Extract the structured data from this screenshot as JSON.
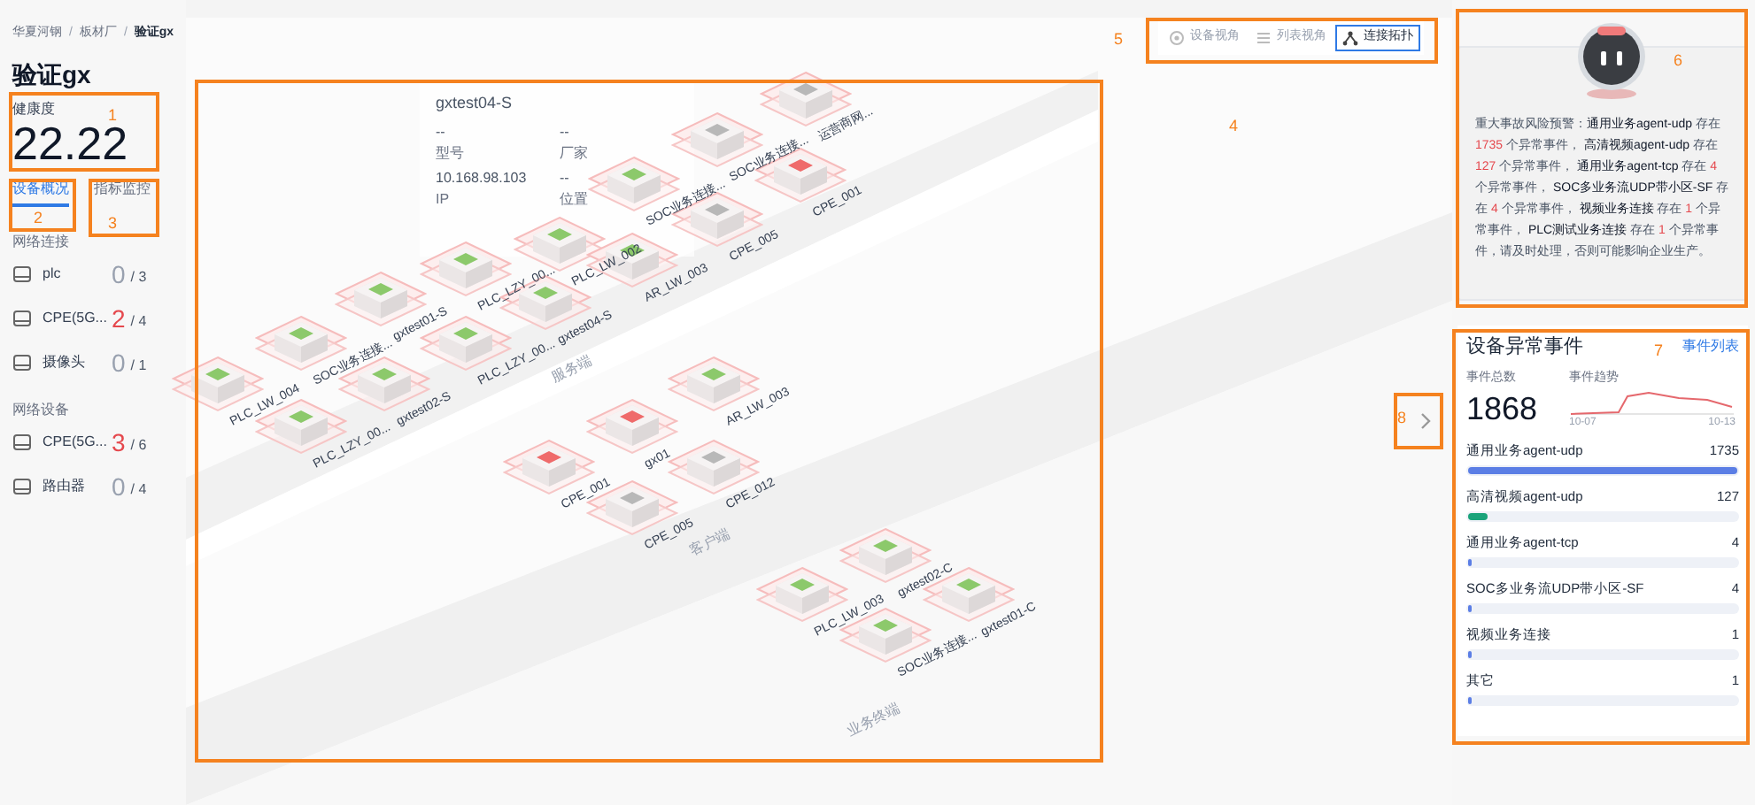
{
  "breadcrumb": [
    {
      "kind": "link",
      "text": "华夏河钢"
    },
    {
      "kind": "separator",
      "text": "/"
    },
    {
      "kind": "link",
      "text": "板材厂"
    },
    {
      "kind": "separator",
      "text": "/"
    },
    {
      "kind": "current",
      "text": "验证gx"
    }
  ],
  "title": "验证gx",
  "health": {
    "label": "健康度",
    "value": "22.22"
  },
  "tabs": [
    {
      "label": "设备概况",
      "selected": true
    },
    {
      "label": "指标监控",
      "selected": false
    }
  ],
  "device_groups": [
    {
      "title": "网络连接",
      "items": [
        {
          "name": "plc",
          "count": "0",
          "total": "/ 3",
          "alert": false
        },
        {
          "name": "CPE(5G...",
          "count": "2",
          "total": "/ 4",
          "alert": true
        },
        {
          "name": "摄像头",
          "count": "0",
          "total": "/ 1",
          "alert": false
        }
      ]
    },
    {
      "title": "网络设备",
      "items": [
        {
          "name": "CPE(5G...",
          "count": "3",
          "total": "/ 6",
          "alert": true
        },
        {
          "name": "路由器",
          "count": "0",
          "total": "/ 4",
          "alert": false
        }
      ]
    }
  ],
  "view_switch": [
    {
      "label": "设备视角",
      "selected": false
    },
    {
      "label": "列表视角",
      "selected": false
    },
    {
      "label": "连接拓扑",
      "selected": true
    }
  ],
  "tooltip": {
    "title": "gxtest04-S",
    "fields": [
      {
        "value": "--",
        "label": "型号"
      },
      {
        "value": "--",
        "label": "厂家"
      },
      {
        "value": "10.168.98.103",
        "label": "IP"
      },
      {
        "value": "--",
        "label": "位置"
      }
    ]
  },
  "topology": {
    "zones": [
      {
        "label": "服务端"
      },
      {
        "label": "客户端"
      },
      {
        "label": "业务终端"
      }
    ],
    "nodes": [
      {
        "label": "运营商网...",
        "color": "#b8b8b8"
      },
      {
        "label": "SOC业务连接...",
        "color": "#b8b8b8"
      },
      {
        "label": "CPE_001",
        "color": "#ef6b6b"
      },
      {
        "label": "SOC业务连接...",
        "color": "#8cc96b"
      },
      {
        "label": "CPE_005",
        "color": "#b8b8b8"
      },
      {
        "label": "PLC_LW_002",
        "color": "#8cc96b"
      },
      {
        "label": "AR_LW_003",
        "color": "#8cc96b"
      },
      {
        "label": "PLC_LZY_00...",
        "color": "#8cc96b"
      },
      {
        "label": "gxtest01-S",
        "color": "#8cc96b"
      },
      {
        "label": "gxtest04-S",
        "color": "#8cc96b"
      },
      {
        "label": "SOC业务连接...",
        "color": "#8cc96b"
      },
      {
        "label": "PLC_LZY_00...",
        "color": "#8cc96b"
      },
      {
        "label": "PLC_LW_004",
        "color": "#8cc96b"
      },
      {
        "label": "gxtest02-S",
        "color": "#8cc96b"
      },
      {
        "label": "PLC_LZY_00...",
        "color": "#8cc96b"
      },
      {
        "label": "AR_LW_003",
        "color": "#8cc96b"
      },
      {
        "label": "gx01",
        "color": "#ef6b6b"
      },
      {
        "label": "CPE_001",
        "color": "#ef6b6b"
      },
      {
        "label": "CPE_012",
        "color": "#b8b8b8"
      },
      {
        "label": "CPE_005",
        "color": "#b8b8b8"
      },
      {
        "label": "gxtest02-C",
        "color": "#8cc96b"
      },
      {
        "label": "PLC_LW_003",
        "color": "#8cc96b"
      },
      {
        "label": "gxtest01-C",
        "color": "#8cc96b"
      },
      {
        "label": "SOC业务连接...",
        "color": "#8cc96b"
      }
    ]
  },
  "alert_card": {
    "segments": [
      {
        "text": "重大事故风险预警：",
        "kind": "plain"
      },
      {
        "text": "通用业务agent-udp",
        "kind": "bold"
      },
      {
        "text": " 存在 ",
        "kind": "plain"
      },
      {
        "text": "1735",
        "kind": "count"
      },
      {
        "text": " 个异常事件， ",
        "kind": "plain"
      },
      {
        "text": "高清视频agent-udp",
        "kind": "bold"
      },
      {
        "text": " 存在 ",
        "kind": "plain"
      },
      {
        "text": "127",
        "kind": "count"
      },
      {
        "text": " 个异常事件， ",
        "kind": "plain"
      },
      {
        "text": "通用业务agent-tcp",
        "kind": "bold"
      },
      {
        "text": " 存在 ",
        "kind": "plain"
      },
      {
        "text": "4",
        "kind": "count"
      },
      {
        "text": " 个异常事件， ",
        "kind": "plain"
      },
      {
        "text": "SOC多业务流UDP带小区-SF",
        "kind": "bold"
      },
      {
        "text": " 存在 ",
        "kind": "plain"
      },
      {
        "text": "4",
        "kind": "count"
      },
      {
        "text": " 个异常事件， ",
        "kind": "plain"
      },
      {
        "text": "视频业务连接",
        "kind": "bold"
      },
      {
        "text": " 存在 ",
        "kind": "plain"
      },
      {
        "text": "1",
        "kind": "count"
      },
      {
        "text": " 个异常事件， ",
        "kind": "plain"
      },
      {
        "text": "PLC测试业务连接",
        "kind": "bold"
      },
      {
        "text": " 存在 ",
        "kind": "plain"
      },
      {
        "text": "1",
        "kind": "count"
      },
      {
        "text": " 个异常事件，请及时处理，否则可能影响企业生产。",
        "kind": "plain"
      }
    ]
  },
  "events": {
    "title": "设备异常事件",
    "link": "事件列表",
    "total_label": "事件总数",
    "total": "1868",
    "trend_label": "事件趋势",
    "trend_start": "10-07",
    "trend_end": "10-13",
    "items": [
      {
        "name": "通用业务agent-udp",
        "count": "1735",
        "level": 1,
        "color": "#5b7ee5"
      },
      {
        "name": "高清视频agent-udp",
        "count": "127",
        "level": 0.07,
        "color": "#1aa37a"
      },
      {
        "name": "通用业务agent-tcp",
        "count": "4",
        "level": 0.002,
        "color": "#5b7ee5"
      },
      {
        "name": "SOC多业务流UDP带小区-SF",
        "count": "4",
        "level": 0.002,
        "color": "#5b7ee5"
      },
      {
        "name": "视频业务连接",
        "count": "1",
        "level": 0.001,
        "color": "#5b7ee5"
      },
      {
        "name": "其它",
        "count": "1",
        "level": 0.001,
        "color": "#5b7ee5"
      }
    ]
  },
  "annotations": [
    {
      "number": "1"
    },
    {
      "number": "2"
    },
    {
      "number": "3"
    },
    {
      "number": "4"
    },
    {
      "number": "5"
    },
    {
      "number": "6"
    },
    {
      "number": "7"
    },
    {
      "number": "8"
    }
  ]
}
